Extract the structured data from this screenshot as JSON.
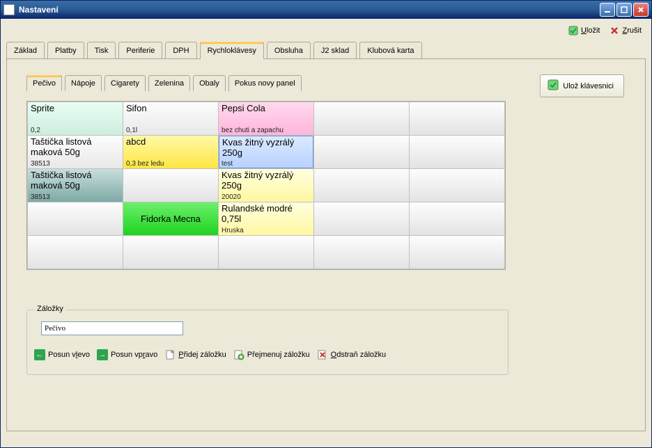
{
  "window": {
    "title": "Nastavení"
  },
  "actions": {
    "save": "Uložit",
    "cancel": "Zrušit"
  },
  "main_tabs": [
    "Základ",
    "Platby",
    "Tisk",
    "Periferie",
    "DPH",
    "Rychloklávesy",
    "Obsluha",
    "J2 sklad",
    "Klubová karta"
  ],
  "main_tab_active": 5,
  "sub_tabs": [
    "Pečivo",
    "Nápoje",
    "Cigarety",
    "Zelenina",
    "Obaly",
    "Pokus novy panel"
  ],
  "sub_tab_active": 0,
  "side_button": "Ulož klávesnici",
  "grid": [
    [
      {
        "title": "Sprite",
        "sub": "0,2",
        "color": "c-mint"
      },
      {
        "title": "Sifon",
        "sub": "0,1l",
        "color": ""
      },
      {
        "title": "Pepsi Cola",
        "sub": "bez chuti a zapachu",
        "color": "c-pink"
      },
      null,
      null
    ],
    [
      {
        "title": "Taštička listová maková 50g",
        "sub": "38513",
        "color": ""
      },
      {
        "title": "abcd",
        "sub": "0,3\nbez ledu",
        "color": "c-yellow"
      },
      {
        "title": "Kvas žitný vyzrálý 250g",
        "sub": "test",
        "color": "c-blue"
      },
      null,
      null
    ],
    [
      {
        "title": "Taštička listová maková 50g",
        "sub": "38513",
        "color": "c-teal"
      },
      null,
      {
        "title": "Kvas žitný vyzrálý 250g",
        "sub": "20020",
        "color": "c-paleyl"
      },
      null,
      null
    ],
    [
      null,
      {
        "title": "Fidorka Mecna",
        "sub": "",
        "color": "c-green",
        "center": true
      },
      {
        "title": "Rulandské modré 0,75l",
        "sub": "Hruska",
        "color": "c-paleyl"
      },
      null,
      null
    ],
    [
      null,
      null,
      null,
      null,
      null
    ]
  ],
  "group": {
    "legend": "Záložky",
    "input_value": "Pečivo",
    "posun_vlevo": "Posun vlevo",
    "posun_vpravo": "Posun vpravo",
    "pridej": "Přidej záložku",
    "prejmenuj": "Přejmenuj záložku",
    "odstran": "Odstraň záložku"
  }
}
